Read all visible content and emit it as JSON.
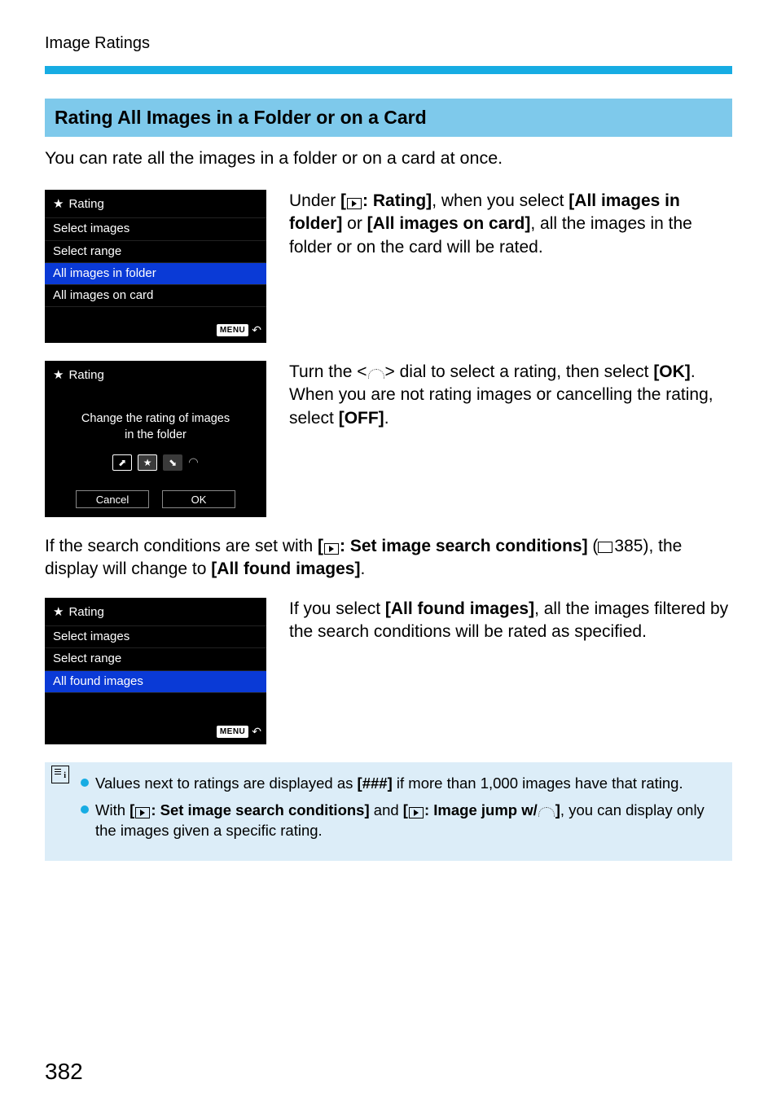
{
  "header": {
    "label": "Image Ratings"
  },
  "section": {
    "title": "Rating All Images in a Folder or on a Card"
  },
  "intro": "You can rate all the images in a folder or on a card at once.",
  "screen1": {
    "title": "Rating",
    "items": [
      "Select images",
      "Select range",
      "All images in folder",
      "All images on card"
    ],
    "selectedIndex": 2,
    "menuLabel": "MENU"
  },
  "block1": {
    "pre": "Under ",
    "b1a": "[",
    "b1b": ": Rating]",
    "mid1": ", when you select ",
    "b2": "[All images in folder]",
    "mid2": " or ",
    "b3": "[All images on card]",
    "tail": ", all the images in the folder or on the card will be rated."
  },
  "screen2": {
    "title": "Rating",
    "line1": "Change the rating of images",
    "line2": "in the folder",
    "cancel": "Cancel",
    "ok": "OK"
  },
  "block2": {
    "l1a": "Turn the <",
    "l1b": "> dial to select a rating, then select ",
    "ok": "[OK]",
    "l1c": ".",
    "l2a": "When you are not rating images or cancelling the rating, select ",
    "off": "[OFF]",
    "l2b": "."
  },
  "para3": {
    "a": "If the search conditions are set with ",
    "b1a": "[",
    "b1b": ": Set image search conditions]",
    "mid": " (",
    "ref": "385",
    "c": "), the display will change to ",
    "b2": "[All found images]",
    "d": "."
  },
  "screen3": {
    "title": "Rating",
    "items": [
      "Select images",
      "Select range",
      "All found images"
    ],
    "selectedIndex": 2,
    "menuLabel": "MENU"
  },
  "block3": {
    "a": "If you select ",
    "b": "[All found images]",
    "c": ", all the images filtered by the search conditions will be rated as specified."
  },
  "notes": {
    "n1a": "Values next to ratings are displayed as ",
    "n1b": "[###]",
    "n1c": " if more than 1,000 images have that rating.",
    "n2a": "With ",
    "n2b1": "[",
    "n2b2": ": Set image search conditions]",
    "n2c": " and ",
    "n2d1": "[",
    "n2d2": ": Image jump w/",
    "n2d3": "]",
    "n2e": ", you can display only the images given a specific rating."
  },
  "pageNumber": "382"
}
